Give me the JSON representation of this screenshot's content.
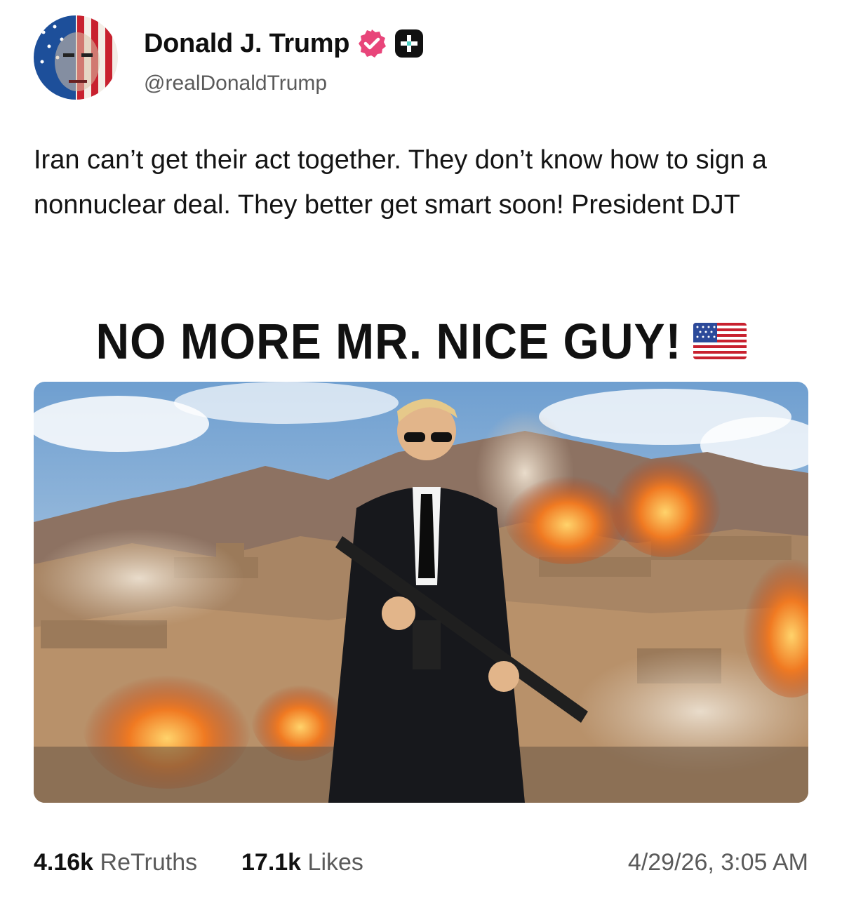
{
  "author": {
    "display_name": "Donald J. Trump",
    "handle": "@realDonaldTrump",
    "avatar_icon": "avatar-image",
    "verified_icon": "verified-badge-icon",
    "verified_color": "#e8457a",
    "plus_icon": "truth-plus-icon"
  },
  "post": {
    "text": "Iran can’t get their act together. They don’t know how to sign a nonnuclear deal. They better get smart soon! President DJT"
  },
  "media": {
    "headline": "NO MORE MR. NICE GUY!",
    "flag_icon": "us-flag-icon",
    "image_icon": "post-image"
  },
  "stats": {
    "retruths_count": "4.16k",
    "retruths_label": "ReTruths",
    "likes_count": "17.1k",
    "likes_label": "Likes",
    "timestamp": "4/29/26, 3:05 AM"
  }
}
